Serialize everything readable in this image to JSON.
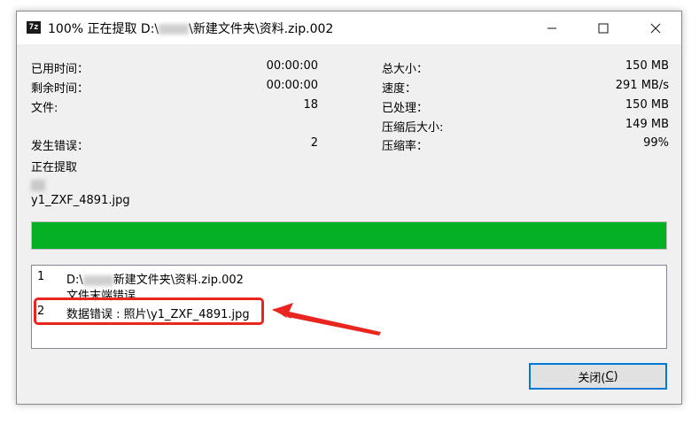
{
  "window": {
    "title_prefix": "100% 正在提取 D:\\",
    "title_suffix": "\\新建文件夹\\资料.zip.002",
    "app_icon_text": "7z",
    "minimize_icon": "minimize-icon",
    "maximize_icon": "maximize-icon",
    "close_icon": "close-icon"
  },
  "stats_left": [
    {
      "label": "已用时间：",
      "value": "00:00:00"
    },
    {
      "label": "剩余时间：",
      "value": "00:00:00"
    },
    {
      "label": "文件:",
      "value": "18"
    },
    {
      "label": "发生错误：",
      "value": "2"
    }
  ],
  "stats_right": [
    {
      "label": "总大小：",
      "value": "150 MB"
    },
    {
      "label": "速度：",
      "value": "291 MB/s"
    },
    {
      "label": "已处理：",
      "value": "150 MB"
    },
    {
      "label": "压缩后大小:",
      "value": "149 MB"
    },
    {
      "label": "压缩率：",
      "value": "99%"
    }
  ],
  "status": {
    "operation": "正在提取",
    "current_file": "y1_ZXF_4891.jpg"
  },
  "progress": {
    "fraction": 1.0,
    "color": "#06b025"
  },
  "log": [
    {
      "num": "1",
      "line1_prefix": "D:\\",
      "line1_suffix": "新建文件夹\\资料.zip.002",
      "line2": "文件末端错误"
    },
    {
      "num": "2",
      "text": "数据错误 : 照片\\y1_ZXF_4891.jpg"
    }
  ],
  "annotation": {
    "color": "#e8261f"
  },
  "buttons": {
    "close_label": "关闭(C)"
  }
}
